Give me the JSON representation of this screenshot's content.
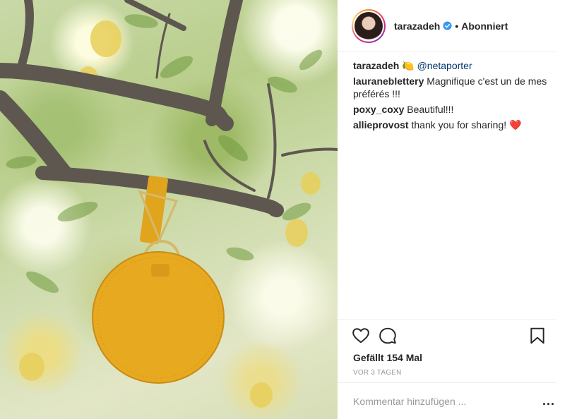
{
  "header": {
    "username": "tarazadeh",
    "verified_icon": "verified-badge-icon",
    "separator": "•",
    "follow_status": "Abonniert"
  },
  "caption": {
    "user": "tarazadeh",
    "emoji": "🍋",
    "mention": "@netaporter"
  },
  "comments": [
    {
      "user": "lauraneblettery",
      "text": "Magnifique c'est un de mes préférés !!!"
    },
    {
      "user": "poxy_coxy",
      "text": "Beautiful!!!"
    },
    {
      "user": "allieprovost",
      "text": "thank you for sharing!",
      "emoji": "❤️"
    }
  ],
  "actions": {
    "like_icon": "heart-icon",
    "comment_icon": "comment-icon",
    "save_icon": "bookmark-icon"
  },
  "likes": "Gefällt 154 Mal",
  "timestamp": "VOR 3 TAGEN",
  "add_comment": {
    "placeholder": "Kommentar hinzufügen ...",
    "more": "..."
  },
  "colors": {
    "bag": "#e6a91f",
    "mention": "#003569",
    "verified": "#3897f0"
  }
}
